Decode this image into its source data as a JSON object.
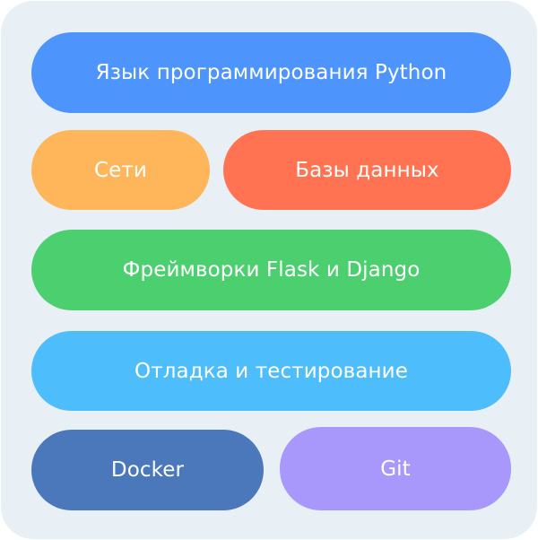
{
  "blocks": [
    {
      "id": "python",
      "label": "Язык программирования Python",
      "color": "#4d95fd"
    },
    {
      "id": "networks",
      "label": "Сети",
      "color": "#ffb55a"
    },
    {
      "id": "databases",
      "label": "Базы данных",
      "color": "#ff7352"
    },
    {
      "id": "frameworks",
      "label": "Фреймворки Flask и Django",
      "color": "#4cd06f"
    },
    {
      "id": "debugging",
      "label": "Отладка и тестирование",
      "color": "#4dbdfc"
    },
    {
      "id": "docker",
      "label": "Docker",
      "color": "#4a78bb"
    },
    {
      "id": "git",
      "label": "Git",
      "color": "#a998fb"
    }
  ],
  "panel_color": "#e9f0f5"
}
